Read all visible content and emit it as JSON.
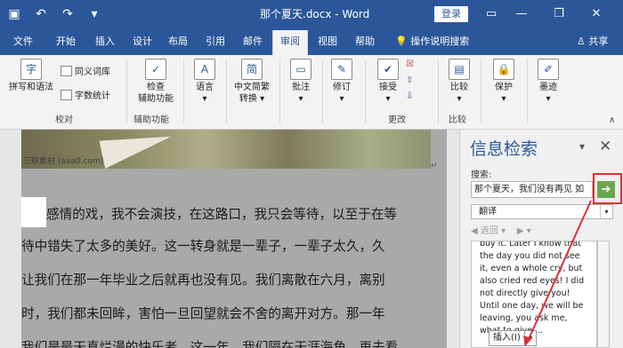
{
  "titlebar": {
    "qat": {
      "save_icon": "▣",
      "undo_icon": "↶",
      "redo_icon": "↷",
      "customize_icon": "▾"
    },
    "document_title": "那个夏天.docx - Word",
    "login_label": "登录",
    "minimize": "—",
    "restore": "❐",
    "close": "✕",
    "display_options": "▭"
  },
  "tabs": [
    "文件",
    "开始",
    "插入",
    "设计",
    "布局",
    "引用",
    "邮件",
    "审阅",
    "视图",
    "帮助"
  ],
  "active_tab": "审阅",
  "tell_me": "💡 操作说明搜索",
  "share": "♙ 共享",
  "ribbon": {
    "spell_label": "拼写和语法",
    "thesaurus_label": "同义词库",
    "wordcount_label": "字数统计",
    "group_proofing": "校对",
    "access_check_label1": "检查",
    "access_check_label2": "辅助功能",
    "group_access": "辅助功能",
    "language_label": "语言",
    "chinese_conv_label1": "中文简繁",
    "chinese_conv_label2": "转换",
    "comment_label": "批注",
    "track_label": "修订",
    "accept_label": "接受",
    "group_changes": "更改",
    "compare_label": "比较",
    "group_compare": "比较",
    "protect_label": "保护",
    "ink_label": "墨迹"
  },
  "document": {
    "watermark": "三联素材 (aaa0.com)",
    "lines": [
      "感情的戏，我不会演技，在这路口，我只会等待，以至于在等",
      "待中错失了太多的美好。这一转身就是一辈子，一辈子太久，久",
      "让我们在那一年毕业之后就再也没有见。我们离散在六月，离别",
      "时，我们都未回眸，害怕一旦回望就会不舍的离开对方。那一年",
      "我们是最天真烂漫的快乐者。这一年，我们隔在天涯海角。再去看"
    ]
  },
  "research_pane": {
    "title": "信息检索",
    "search_label": "搜索:",
    "search_value": "那个夏天，我们没有再见 如",
    "go_icon": "➔",
    "source": "翻译",
    "back": "◀ 返回",
    "forward": "▶",
    "result": "buy it. Later I know that the day you did not see it, even a whole cry, but also cried red eyes! I did not directly give you! Until one day, we will be leaving, you ask me, what to give ...",
    "insert_label": "插入(I)",
    "close_icon": "✕",
    "dropdown_icon": "▾"
  },
  "colors": {
    "brand": "#2b579a",
    "highlight": "#e03030",
    "go": "#6aa84f"
  }
}
